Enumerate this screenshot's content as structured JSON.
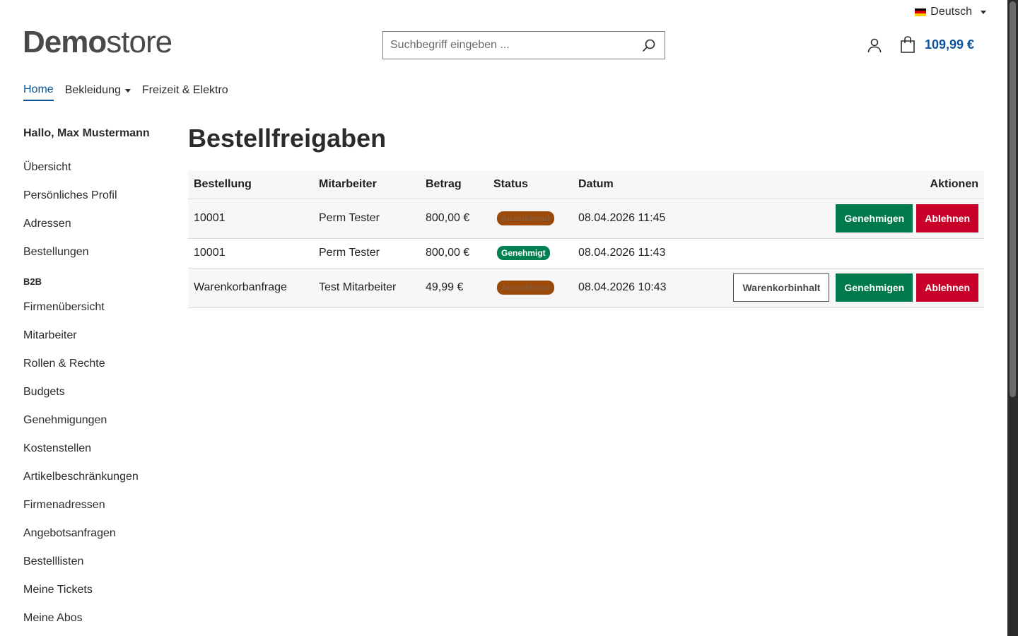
{
  "header": {
    "language": "Deutsch",
    "flag_colors": [
      "#000000",
      "#dd0000",
      "#ffce00"
    ],
    "logo_bold": "Demo",
    "logo_light": "store",
    "search_placeholder": "Suchbegriff eingeben ...",
    "cart_total": "109,99 €"
  },
  "nav": {
    "items": [
      {
        "label": "Home",
        "active": true
      },
      {
        "label": "Bekleidung",
        "dropdown": true
      },
      {
        "label": "Freizeit & Elektro"
      }
    ]
  },
  "sidebar": {
    "greeting": "Hallo, Max Mustermann",
    "links_top": [
      "Übersicht",
      "Persönliches Profil",
      "Adressen",
      "Bestellungen"
    ],
    "section_label": "B2B",
    "links_b2b": [
      "Firmenübersicht",
      "Mitarbeiter",
      "Rollen & Rechte",
      "Budgets",
      "Genehmigungen",
      "Kostenstellen",
      "Artikelbeschränkungen",
      "Firmenadressen",
      "Angebotsanfragen",
      "Bestelllisten",
      "Meine Tickets",
      "Meine Abos"
    ]
  },
  "main": {
    "title": "Bestellfreigaben",
    "columns": [
      "Bestellung",
      "Mitarbeiter",
      "Betrag",
      "Status",
      "Datum",
      "Aktionen"
    ],
    "rows": [
      {
        "order": "10001",
        "employee": "Perm Tester",
        "amount": "800,00 €",
        "status": "Ausstehend",
        "status_type": "pending",
        "date": "08.04.2026 11:45",
        "actions": [
          "Genehmigen",
          "Ablehnen"
        ]
      },
      {
        "order": "10001",
        "employee": "Perm Tester",
        "amount": "800,00 €",
        "status": "Genehmigt",
        "status_type": "approved",
        "date": "08.04.2026 11:43",
        "actions": []
      },
      {
        "order": "Warenkorbanfrage",
        "employee": "Test Mitarbeiter",
        "amount": "49,99 €",
        "status": "Ausstehend",
        "status_type": "pending",
        "date": "08.04.2026 10:43",
        "actions": [
          "Warenkorbinhalt",
          "Genehmigen",
          "Ablehnen"
        ]
      }
    ]
  },
  "colors": {
    "primary": "#0b539b",
    "approve": "#007a4d",
    "reject": "#c8002a",
    "pending": "#9b4a0a"
  }
}
